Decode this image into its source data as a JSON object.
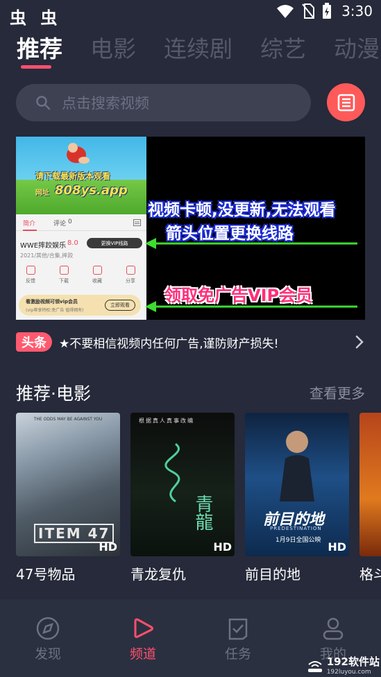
{
  "status_bar": {
    "left_icons": "虫 虫",
    "time": "3:30"
  },
  "top_tabs": [
    "推荐",
    "电影",
    "连续剧",
    "综艺",
    "动漫"
  ],
  "search": {
    "placeholder": "点击搜索视频"
  },
  "banner": {
    "app_image_title": "请下载最新版本观看",
    "app_image_url_label": "网址",
    "app_image_url": "808ys.app",
    "mini_tab_intro": "简介",
    "mini_tab_comments": "评论",
    "mini_tab_comment_count": "0",
    "mini_title": "WWE摔跤娱乐",
    "mini_score": "8.0",
    "mini_pill": "更换VIP线路",
    "mini_meta": "2021/其他/合集,摔跤",
    "mini_actions": [
      "反馈",
      "下载",
      "收藏",
      "分享"
    ],
    "mini_card_line1": "看激励视频可领vip会员",
    "mini_card_line2": "(vip尊享特权:免广告 值得拥有)",
    "mini_card_button": "立即观看",
    "line1": "视频卡顿,没更新,无法观看",
    "line2": "箭头位置更换线路",
    "line3": "领取免广告VIP会员"
  },
  "notice": {
    "badge": "头条",
    "text": "★不要相信视频内任何广告,谨防财产损失!"
  },
  "section": {
    "title": "推荐·电影",
    "more": "查看更多"
  },
  "movies": [
    {
      "title": "47号物品",
      "badge": "HD",
      "poster_text": "ITEM 47",
      "poster_top": "THE ODDS MAY BE AGAINST YOU"
    },
    {
      "title": "青龙复仇",
      "badge": "HD",
      "poster_text": "青龍",
      "poster_top": "根据真人真事改编"
    },
    {
      "title": "前目的地",
      "badge": "HD",
      "poster_text": "前目的地",
      "poster_en": "PREDESTINATION",
      "poster_sub": "1月9日全国公映"
    },
    {
      "title": "格斗",
      "badge": ""
    }
  ],
  "bottom_nav": [
    {
      "label": "发现",
      "icon": "compass-icon",
      "active": false
    },
    {
      "label": "频道",
      "icon": "play-icon",
      "active": true
    },
    {
      "label": "任务",
      "icon": "task-check-icon",
      "active": false
    },
    {
      "label": "我的",
      "icon": "user-icon",
      "active": false
    }
  ],
  "watermark": {
    "main": "192软件站",
    "sub": "192luyou.com"
  },
  "colors": {
    "accent": "#ff4f6f",
    "background": "#262a3a",
    "nav_background": "#2b3040"
  }
}
